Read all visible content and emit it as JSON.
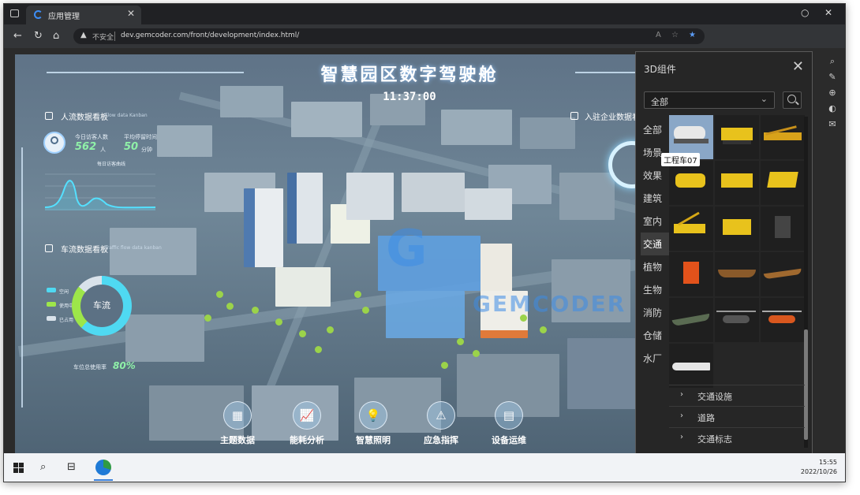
{
  "browser": {
    "tab_title": "应用管理",
    "url_security": "不安全",
    "url": "dev.gemcoder.com/front/development/index.html/",
    "window_controls": [
      "restore-icon",
      "close-icon"
    ]
  },
  "dashboard": {
    "title": "智慧园区数字驾驶舱",
    "clock": "11:37:00",
    "people_panel": {
      "title": "人流数据看板",
      "subtitle": "Flow data Kanban",
      "today_visitors_label": "今日访客人数",
      "today_visitors_value": "562",
      "today_visitors_unit": "人",
      "avg_stay_label": "平均停留时间",
      "avg_stay_value": "50",
      "avg_stay_unit": "分钟",
      "chart_label": "每日访客曲线"
    },
    "traffic_panel": {
      "title": "车流数据看板",
      "subtitle": "Traffic flow data kanban",
      "donut_label": "车流",
      "legend": [
        "空闲",
        "使用中",
        "已占用"
      ],
      "occupancy_label": "车位总使用率",
      "occupancy_value": "80%"
    },
    "enterprise_panel": {
      "title": "入驻企业数据看板"
    },
    "dock": [
      {
        "label": "主题数据",
        "glyph": "▦"
      },
      {
        "label": "能耗分析",
        "glyph": "📈"
      },
      {
        "label": "智慧照明",
        "glyph": "💡"
      },
      {
        "label": "应急指挥",
        "glyph": "⚠"
      },
      {
        "label": "设备运维",
        "glyph": "▤"
      }
    ],
    "watermark": "GEMCODER",
    "colors": {
      "accent": "#8ff0a8",
      "donut_main": "#4fd9f2",
      "donut_second": "#9de64a"
    }
  },
  "component_panel": {
    "title": "3D组件",
    "select_value": "全部",
    "categories": [
      "全部",
      "场景",
      "效果",
      "建筑",
      "室内",
      "交通",
      "植物",
      "生物",
      "消防",
      "仓储",
      "水厂"
    ],
    "active_category": "交通",
    "tooltip": "工程车07",
    "tree": [
      "交通设施",
      "道路",
      "交通标志"
    ]
  },
  "taskbar": {
    "time": "15:55",
    "date": "2022/10/26"
  }
}
